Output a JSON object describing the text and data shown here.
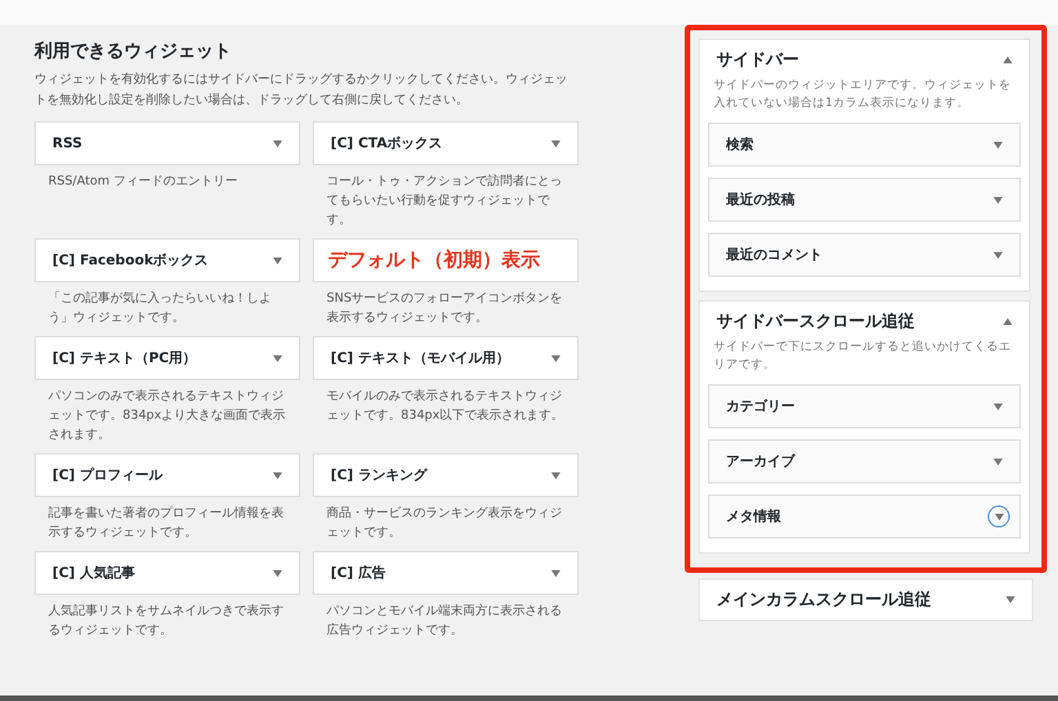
{
  "available": {
    "title": "利用できるウィジェット",
    "description": "ウィジェットを有効化するにはサイドバーにドラッグするかクリックしてください。ウィジェットを無効化し設定を削除したい場合は、ドラッグして右側に戻してください。",
    "widgets": [
      {
        "title": "RSS",
        "description": "RSS/Atom フィードのエントリー"
      },
      {
        "title": "[C] CTAボックス",
        "description": "コール・トゥ・アクションで訪問者にとってもらいたい行動を促すウィジェットです。"
      },
      {
        "title": "[C] Facebookボックス",
        "description": "「この記事が気に入ったらいいね！しよう」ウィジェットです。"
      },
      {
        "description": "SNSサービスのフォローアイコンボタンを表示するウィジェットです。"
      },
      {
        "title": "[C] テキスト（PC用）",
        "description": "パソコンのみで表示されるテキストウィジェットです。834pxより大きな画面で表示されます。"
      },
      {
        "title": "[C] テキスト（モバイル用）",
        "description": "モバイルのみで表示されるテキストウィジェットです。834px以下で表示されます。"
      },
      {
        "title": "[C] プロフィール",
        "description": "記事を書いた著者のプロフィール情報を表示するウィジェットです。"
      },
      {
        "title": "[C] ランキング",
        "description": "商品・サービスのランキング表示をウィジェットです。"
      },
      {
        "title": "[C] 人気記事",
        "description": "人気記事リストをサムネイルつきで表示するウィジェットです。"
      },
      {
        "title": "[C] 広告",
        "description": "パソコンとモバイル端末両方に表示される広告ウィジェットです。"
      }
    ]
  },
  "annotation": "デフォルト（初期）表示",
  "highlighted_areas": [
    {
      "title": "サイドバー",
      "expanded": true,
      "description": "サイドバーのウィジットエリアです。ウィジェットを入れていない場合は1カラム表示になります。",
      "widgets": [
        {
          "title": "検索",
          "focused": false
        },
        {
          "title": "最近の投稿",
          "focused": false
        },
        {
          "title": "最近のコメント",
          "focused": false
        }
      ]
    },
    {
      "title": "サイドバースクロール追従",
      "expanded": true,
      "description": "サイドバーで下にスクロールすると追いかけてくるエリアです。",
      "widgets": [
        {
          "title": "カテゴリー",
          "focused": false
        },
        {
          "title": "アーカイブ",
          "focused": false
        },
        {
          "title": "メタ情報",
          "focused": true
        }
      ]
    }
  ],
  "other_areas": [
    {
      "title": "メインカラムスクロール追従",
      "expanded": false
    }
  ]
}
